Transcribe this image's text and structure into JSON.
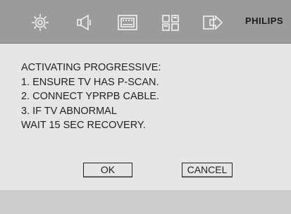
{
  "header": {
    "brand": "PHILIPS",
    "icons": [
      "gear-icon",
      "speaker-icon",
      "display-icon",
      "grid-icon",
      "export-icon"
    ]
  },
  "dialog": {
    "lines": [
      "ACTIVATING PROGRESSIVE:",
      "1. ENSURE TV HAS P-SCAN.",
      "2. CONNECT YPRPB CABLE.",
      "3. IF TV ABNORMAL",
      "WAIT 15 SEC RECOVERY."
    ],
    "ok_label": "OK",
    "cancel_label": "CANCEL"
  }
}
